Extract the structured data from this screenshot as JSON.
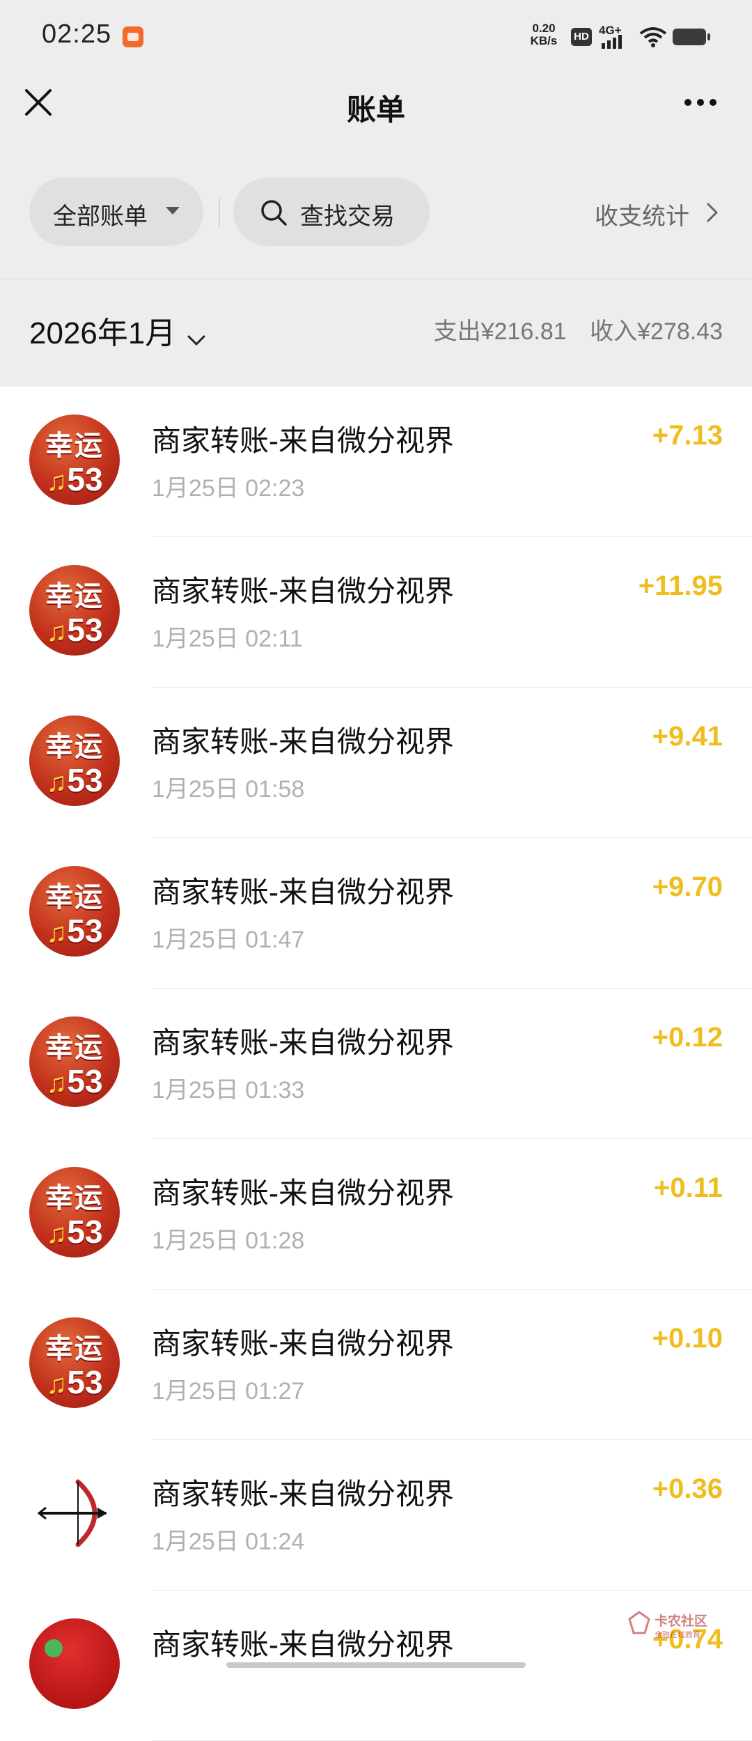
{
  "status_bar": {
    "time": "02:25",
    "net_speed_value": "0.20",
    "net_speed_unit": "KB/s",
    "hd_label": "HD",
    "network_label": "4G+"
  },
  "nav": {
    "title": "账单",
    "close_icon": "close-icon",
    "more_icon": "more-icon"
  },
  "filters": {
    "all_bills": "全部账单",
    "search": "查找交易",
    "stats": "收支统计"
  },
  "month": {
    "label": "2026年1月",
    "expense": "支出¥216.81",
    "income": "收入¥278.43"
  },
  "colors": {
    "amount": "#f0bd1e",
    "background_top": "#ededed"
  },
  "transactions": [
    {
      "title": "商家转账-来自微分视界",
      "time": "1月25日 02:23",
      "amount": "+7.13",
      "avatar": "lucky53",
      "avatar_top": "幸运",
      "avatar_bottom": "53"
    },
    {
      "title": "商家转账-来自微分视界",
      "time": "1月25日 02:11",
      "amount": "+11.95",
      "avatar": "lucky53",
      "avatar_top": "幸运",
      "avatar_bottom": "53"
    },
    {
      "title": "商家转账-来自微分视界",
      "time": "1月25日 01:58",
      "amount": "+9.41",
      "avatar": "lucky53",
      "avatar_top": "幸运",
      "avatar_bottom": "53"
    },
    {
      "title": "商家转账-来自微分视界",
      "time": "1月25日 01:47",
      "amount": "+9.70",
      "avatar": "lucky53",
      "avatar_top": "幸运",
      "avatar_bottom": "53"
    },
    {
      "title": "商家转账-来自微分视界",
      "time": "1月25日 01:33",
      "amount": "+0.12",
      "avatar": "lucky53",
      "avatar_top": "幸运",
      "avatar_bottom": "53"
    },
    {
      "title": "商家转账-来自微分视界",
      "time": "1月25日 01:28",
      "amount": "+0.11",
      "avatar": "lucky53",
      "avatar_top": "幸运",
      "avatar_bottom": "53"
    },
    {
      "title": "商家转账-来自微分视界",
      "time": "1月25日 01:27",
      "amount": "+0.10",
      "avatar": "lucky53",
      "avatar_top": "幸运",
      "avatar_bottom": "53"
    },
    {
      "title": "商家转账-来自微分视界",
      "time": "1月25日 01:24",
      "amount": "+0.36",
      "avatar": "bow-arrow"
    },
    {
      "title": "商家转账-来自微分视界",
      "time": "",
      "amount": "+0.74",
      "avatar": "red-circle"
    }
  ],
  "watermark": {
    "text": "卡农社区",
    "sub": "金融在线教育"
  }
}
